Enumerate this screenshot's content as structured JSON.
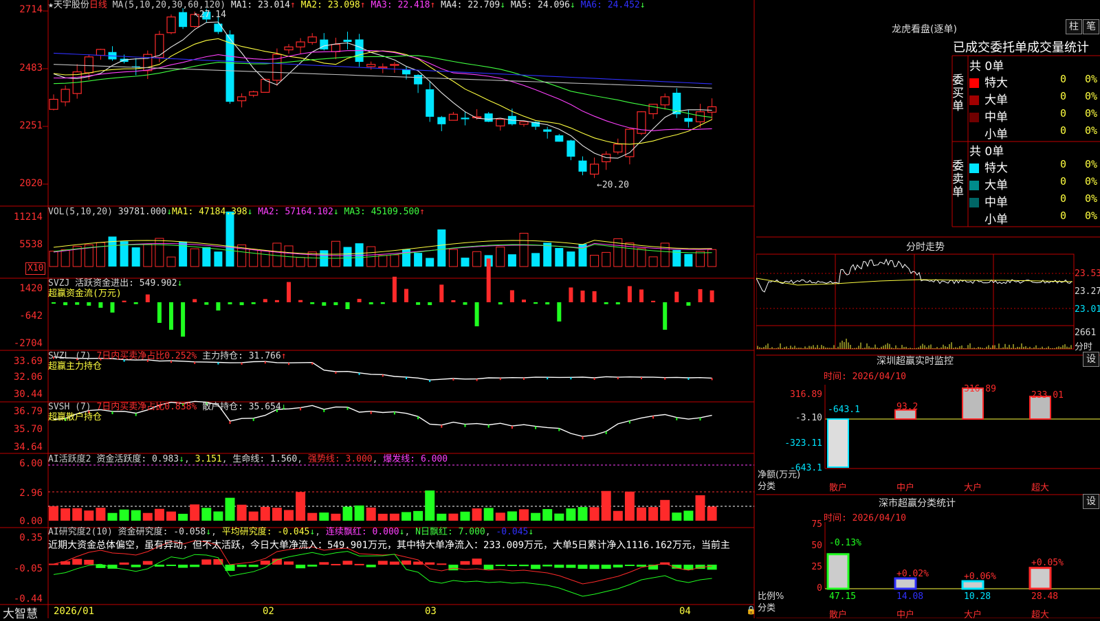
{
  "colors": {
    "up": "#ff2a2a",
    "down": "#00e5ff",
    "ma1": "#e8e8e8",
    "ma2": "#ffff40",
    "ma3": "#ff40ff",
    "ma4": "#40ff40",
    "ma5": "#c0c0c0",
    "ma6": "#3030ff",
    "grid": "#c00000"
  },
  "main": {
    "stock": "★天宇股份",
    "period": "日线",
    "ma_label": "MA(5,10,20,30,60,120)",
    "ma": [
      {
        "l": "MA1: 23.014",
        "a": "↑"
      },
      {
        "l": "MA2: 23.098",
        "a": "↑"
      },
      {
        "l": "MA3: 22.418",
        "a": "↑"
      },
      {
        "l": "MA4: 22.709",
        "a": "↓"
      },
      {
        "l": "MA5: 24.096",
        "a": "↓"
      },
      {
        "l": "MA6: 24.452",
        "a": "↓"
      }
    ],
    "yticks": [
      "2714",
      "2483",
      "2251",
      "2020"
    ],
    "high_mark": "27.14",
    "low_mark": "20.20"
  },
  "vol": {
    "label": "VOL(5,10,20)",
    "value": "39781.000",
    "a0": "↓",
    "ma1": "MA1: 47184.398",
    "a1": "↓",
    "ma2": "MA2: 57164.102",
    "a2": "↓",
    "ma3": "MA3: 45109.500",
    "a3": "↑",
    "yticks": [
      "11214",
      "5538"
    ],
    "unit": "X10"
  },
  "svzj": {
    "name": "SVZJ",
    "desc": "活跃资金进出: 549.902",
    "arrow": "↓",
    "sub": "超赢资金流(万元)",
    "yticks": [
      "1420",
      "-642",
      "-2704"
    ]
  },
  "svzl": {
    "name": "SVZL (7)",
    "part1": "7日内买卖净占比0.252%",
    "part2": "主力持仓: 31.766",
    "arrow": "↑",
    "sub": "超赢主力持仓",
    "yticks": [
      "33.69",
      "32.06",
      "30.44"
    ]
  },
  "svsh": {
    "name": "SVSH (7)",
    "part1": "7日内买卖净占比0.838%",
    "part2": "散户持仓: 35.654",
    "arrow": "↓",
    "sub": "超赢散户持仓",
    "yticks": [
      "36.79",
      "35.70",
      "34.64"
    ]
  },
  "ai1": {
    "name": "AI活跃度2",
    "a": "资金活跃度: 0.983",
    "b": "3.151",
    "c": "生命线: 1.560",
    "d": "强势线: 3.000",
    "e": "爆发线: 6.000",
    "yticks": [
      "6.00",
      "2.96",
      "0.00"
    ]
  },
  "ai2": {
    "name": "AI研究度2(10)",
    "a": "资金研究度: -0.058",
    "b": "平均研究度: -0.045",
    "c": "连续飘红: 0.000",
    "d": "N日飘红: 7.000",
    "e": "-0.045",
    "text": "近期大资金总体偏空，虽有异动，但不太活跃，今日大单净流入：549.901万元，其中特大单净流入：233.009万元，大单5日累计净入1116.162万元，当前主",
    "yticks": [
      "0.35",
      "-0.05",
      "-0.44"
    ]
  },
  "xaxis": {
    "logo": "大智慧",
    "labels": [
      "2026/01",
      "02",
      "03",
      "04"
    ]
  },
  "lhb": {
    "title": "龙虎看盘(逐单)",
    "btn1": "柱",
    "btn2": "笔",
    "subtitle": "已成交委托单成交量统计",
    "buy": {
      "label": "委买单",
      "total": "共 0单",
      "rows": [
        {
          "n": "特大",
          "v": "0",
          "p": "0%"
        },
        {
          "n": "大单",
          "v": "0",
          "p": "0%"
        },
        {
          "n": "中单",
          "v": "0",
          "p": "0%"
        },
        {
          "n": "小单",
          "v": "0",
          "p": "0%"
        }
      ],
      "colors": [
        "#ff0000",
        "#a00000",
        "#700000",
        "#000000"
      ]
    },
    "sell": {
      "label": "委卖单",
      "total": "共 0单",
      "rows": [
        {
          "n": "特大",
          "v": "0",
          "p": "0%"
        },
        {
          "n": "大单",
          "v": "0",
          "p": "0%"
        },
        {
          "n": "中单",
          "v": "0",
          "p": "0%"
        },
        {
          "n": "小单",
          "v": "0",
          "p": "0%"
        }
      ],
      "colors": [
        "#00e5ff",
        "#008b8b",
        "#006666",
        "#000000"
      ]
    }
  },
  "fenshi": {
    "title": "分时走势",
    "yticks": [
      "23.53",
      "23.27",
      "23.01"
    ],
    "vol": "2661",
    "vol_unit": "分时"
  },
  "sz": {
    "title": "深圳超赢实时监控",
    "btn": "设",
    "date": "时间: 2026/04/10",
    "yticks": [
      "316.89",
      "-3.10",
      "-323.11",
      "-643.1"
    ],
    "ylabel1": "净额(万元)",
    "ylabel2": "分类",
    "cats": [
      "散户",
      "中户",
      "大户",
      "超大"
    ],
    "values": [
      -643.1,
      93.2,
      316.89,
      233.01
    ],
    "labels": [
      "-643.1",
      "93.2",
      "316.89",
      "233.01"
    ]
  },
  "ss": {
    "title": "深市超赢分类统计",
    "btn": "设",
    "date": "时间: 2026/04/10",
    "yticks": [
      "75",
      "50",
      "25",
      "0"
    ],
    "ylabel1": "比例%",
    "ylabel2": "分类",
    "cats": [
      "散户",
      "中户",
      "大户",
      "超大"
    ],
    "values": [
      47.15,
      14.08,
      10.28,
      28.48
    ],
    "chg": [
      "-0.13%",
      "+0.02%",
      "+0.06%",
      "+0.05%"
    ],
    "vals": [
      "47.15",
      "14.08",
      "10.28",
      "28.48"
    ]
  }
}
